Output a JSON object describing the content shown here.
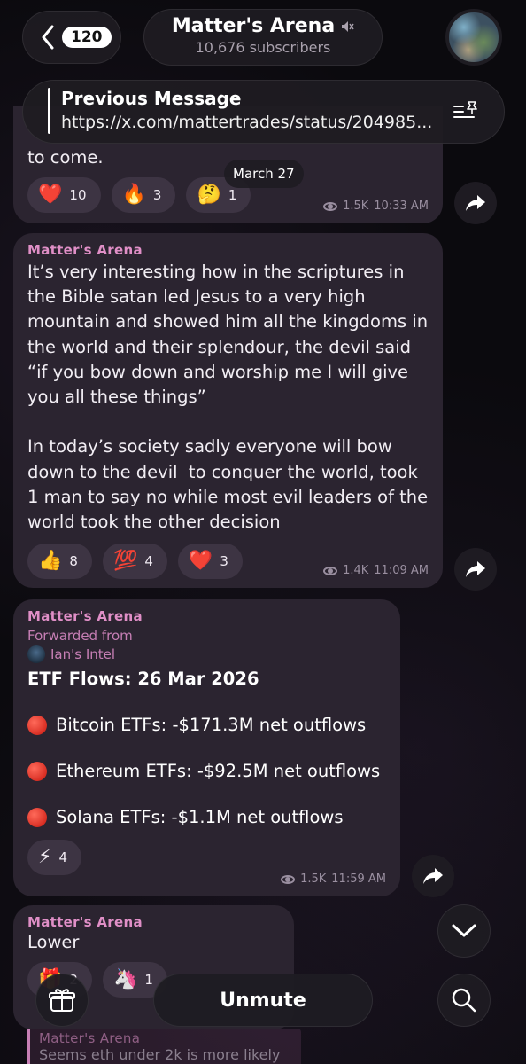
{
  "header": {
    "back_count": "120",
    "channel_title": "Matter's Arena",
    "subscribers": "10,676 subscribers",
    "muted_icon": "speaker-muted-icon"
  },
  "pinned": {
    "title": "Previous Message",
    "link": "https://x.com/mattertrades/status/204985..."
  },
  "date_badge": "March 27",
  "messages": [
    {
      "partial_text": "to come.",
      "reactions": [
        {
          "emoji": "❤️",
          "count": "10"
        },
        {
          "emoji": "🔥",
          "count": "3"
        },
        {
          "emoji": "🤔",
          "count": "1"
        }
      ],
      "views": "1.5K",
      "time": "10:33 AM"
    },
    {
      "sender": "Matter's Arena",
      "text": "It’s very interesting how in the scriptures in the Bible satan led Jesus to a very high mountain and showed him all the kingdoms in the world and their splendour, the devil said “if you bow down and worship me I will give you all these things”\n\nIn today’s society sadly everyone will bow down to the devil  to conquer the world, took 1 man to say no while most evil leaders of the world took the other decision",
      "reactions": [
        {
          "emoji": "👍",
          "count": "8"
        },
        {
          "emoji": "💯",
          "count": "4"
        },
        {
          "emoji": "❤️",
          "count": "3"
        }
      ],
      "views": "1.4K",
      "time": "11:09 AM"
    },
    {
      "sender": "Matter's Arena",
      "forwarded_label": "Forwarded from",
      "forwarded_source": "Ian's Intel",
      "title": "ETF Flows: 26 Mar 2026",
      "lines": [
        "Bitcoin ETFs: -$171.3M net outflows",
        "Ethereum ETFs: -$92.5M net outflows",
        "Solana ETFs: -$1.1M net outflows"
      ],
      "reactions": [
        {
          "emoji": "⚡",
          "count": "4"
        }
      ],
      "views": "1.5K",
      "time": "11:59 AM"
    },
    {
      "sender": "Matter's Arena",
      "text": "Lower",
      "reactions": [
        {
          "emoji": "🎁",
          "count": "2"
        },
        {
          "emoji": "🦄",
          "count": "1"
        }
      ]
    }
  ],
  "reply_preview": {
    "sender": "Matter's Arena",
    "text": "Seems eth under 2k is more likely"
  },
  "bottom": {
    "unmute_label": "Unmute"
  },
  "colors": {
    "accent_pink": "#e08fc7",
    "bubble_bg": "#2b2430",
    "reaction_bg": "#3d3443"
  }
}
